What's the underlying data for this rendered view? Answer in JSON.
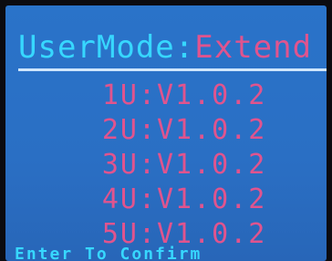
{
  "header": {
    "label": "UserMode",
    "separator": ":",
    "value": "Extend"
  },
  "modules": [
    {
      "id": "1U",
      "version": "V1.0.2"
    },
    {
      "id": "2U",
      "version": "V1.0.2"
    },
    {
      "id": "3U",
      "version": "V1.0.2"
    },
    {
      "id": "4U",
      "version": "V1.0.2"
    },
    {
      "id": "5U",
      "version": "V1.0.2"
    }
  ],
  "footer": {
    "hint": "Enter To Confirm"
  },
  "colors": {
    "background": "#2a6fc4",
    "label": "#37d7ff",
    "value": "#e0548e",
    "rule": "#cfe6ff"
  }
}
